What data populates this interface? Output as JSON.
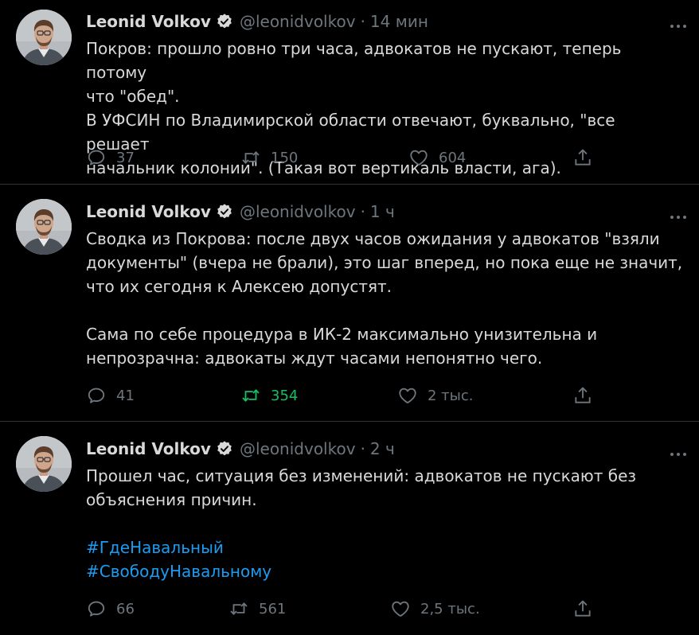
{
  "tweets": [
    {
      "name": "Leonid Volkov",
      "handle": "@leonidvolkov",
      "time": "14 мин",
      "lines": [
        "Покров: прошло ровно три часа, адвокатов не пускают, теперь потому",
        "что \"обед\".",
        "В УФСИН по Владимирской области отвечают, буквально, \"все решает",
        "начальник колонии\". (Такая вот вертикаль власти, ага)."
      ],
      "replies": "37",
      "retweets": "150",
      "likes": "604"
    },
    {
      "name": "Leonid Volkov",
      "handle": "@leonidvolkov",
      "time": "1 ч",
      "lines": [
        "Сводка из Покрова: после двух часов ожидания у адвокатов \"взяли",
        "документы\" (вчера не брали), это шаг вперед, но пока еще не значит,",
        "что их сегодня к Алексею допустят.",
        "",
        "Сама по себе процедура в ИК-2 максимально унизительна и",
        "непрозрачна: адвокаты ждут часами непонятно чего."
      ],
      "replies": "41",
      "retweets": "354",
      "likes": "2 тыс."
    },
    {
      "name": "Leonid Volkov",
      "handle": "@leonidvolkov",
      "time": "2 ч",
      "lines": [
        "Прошел час, ситуация без изменений: адвокатов не пускают без",
        "объяснения причин."
      ],
      "hashtags": [
        "#ГдеНавальный",
        "#СвободуНавальному"
      ],
      "replies": "66",
      "retweets": "561",
      "likes": "2,5 тыс."
    }
  ],
  "colors": {
    "background": "#000000",
    "text": "#d9d9d9",
    "muted": "#6e767d",
    "divider": "#2f3336",
    "link": "#1d9bf0",
    "retweet_active": "#17bf63",
    "verified": "#d9d9d9"
  },
  "icons": [
    "reply-icon",
    "retweet-icon",
    "like-icon",
    "share-icon",
    "verified-badge-icon",
    "more-options-icon"
  ]
}
